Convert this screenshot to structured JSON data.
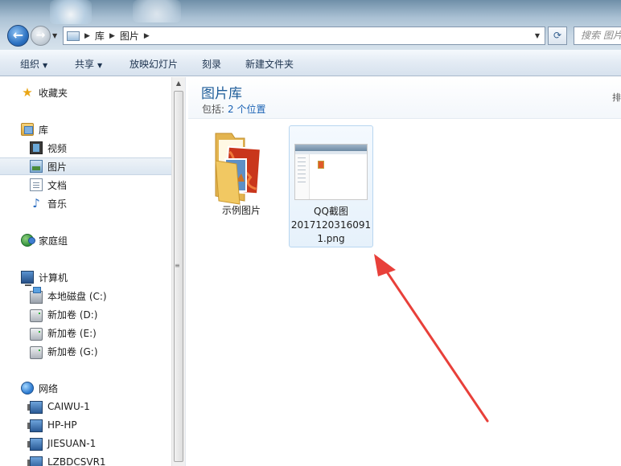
{
  "address": {
    "crumbs": [
      "库",
      "图片"
    ],
    "search_placeholder": "搜索 图片"
  },
  "toolbar": {
    "organize": "组织",
    "share": "共享",
    "slideshow": "放映幻灯片",
    "burn": "刻录",
    "new_folder": "新建文件夹"
  },
  "sidebar": {
    "favorites": "收藏夹",
    "libraries": "库",
    "lib_items": [
      "视频",
      "图片",
      "文档",
      "音乐"
    ],
    "homegroup": "家庭组",
    "computer": "计算机",
    "drives": [
      "本地磁盘 (C:)",
      "新加卷 (D:)",
      "新加卷 (E:)",
      "新加卷 (G:)"
    ],
    "network": "网络",
    "hosts": [
      "CAIWU-1",
      "HP-HP",
      "JIESUAN-1",
      "LZBDCSVR1"
    ]
  },
  "content": {
    "title": "图片库",
    "includes_label": "包括:",
    "locations_link": "2 个位置",
    "right_hint": "排"
  },
  "files": [
    {
      "name": "示例图片"
    },
    {
      "name_lines": [
        "QQ截图",
        "2017120316091",
        "1.png"
      ]
    }
  ],
  "icons": {
    "back": "back-arrow-icon",
    "forward": "forward-arrow-icon",
    "refresh": "refresh-icon"
  },
  "colors": {
    "accent": "#1e5d99",
    "link": "#1a62b4",
    "annotation_arrow": "#e8403a"
  }
}
